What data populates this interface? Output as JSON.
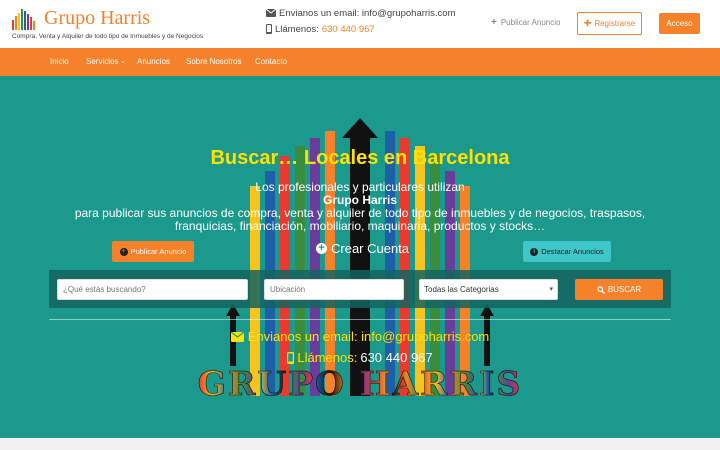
{
  "header": {
    "brand": "Grupo Harris",
    "tagline": "Compra, Venta y Alquiler de todo tipo de Inmuebles y de Negocios",
    "email_label": "Envianos un email: info@grupoharris.com",
    "phone_label": "Llámenos:",
    "phone_number": "630 440 967",
    "publish_link": "Publicar Anuncio",
    "register_button": "Registrarse",
    "login_button": "Acceso"
  },
  "nav": {
    "items": [
      {
        "label": "Inicio"
      },
      {
        "label": "Servicios"
      },
      {
        "label": "Anuncios"
      },
      {
        "label": "Sobre Nosotros"
      },
      {
        "label": "Contacto"
      }
    ]
  },
  "hero": {
    "title": "Buscar… Locales en Barcelona",
    "line1": "Los profesionales y particulares utilizan",
    "line2": "Grupo Harris",
    "line3": "para publicar sus anuncios de compra, venta y alquiler de todo tipo de inmuebles y de negocios, traspasos,",
    "line4": "franquicias, financiación, mobiliario, maquinaria, productos y stocks…",
    "publish_button": "Publicar Anuncio",
    "create_account": "Crear Cuenta",
    "feature_button": "Destacar Anuncios"
  },
  "search": {
    "query_placeholder": "¿Qué estás buscando?",
    "location_placeholder": "Ubicación",
    "category_selected": "Todas las Categorias",
    "search_button": "BUSCAR"
  },
  "footer_contact": {
    "email_line": "Envianos un email: info@grupoharris.com",
    "phone_label": "Llámenos:",
    "phone_number": "630 440 967",
    "brand_big": "GRUPO HARRIS"
  },
  "colors": {
    "brand_orange": "#f5822a",
    "hero_teal": "#1b998c",
    "accent_yellow": "#ffe100",
    "feature_cyan": "#3ec6c9"
  },
  "icons": [
    "logo-icon",
    "envelope-icon",
    "phone-icon",
    "plus-icon",
    "plus-square-icon",
    "plus-circle-icon",
    "info-circle-icon",
    "search-icon",
    "chevron-down-icon"
  ]
}
